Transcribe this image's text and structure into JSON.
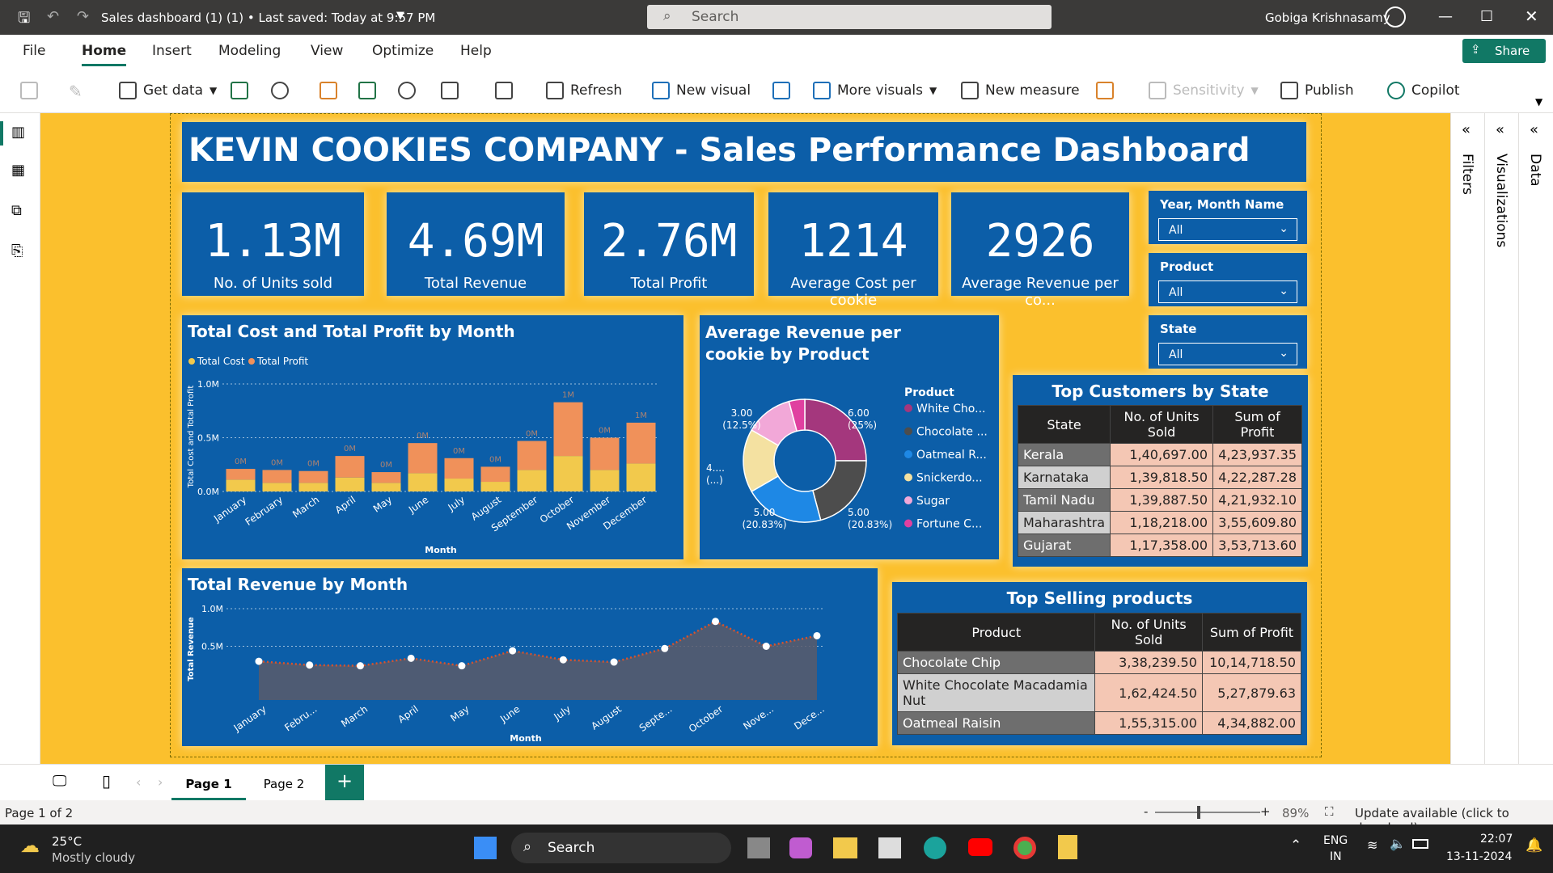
{
  "titlebar": {
    "title": "Sales dashboard (1) (1) • Last saved: Today at 9:57 PM",
    "search": "Search",
    "user": "Gobiga Krishnasamy"
  },
  "menu": [
    "File",
    "Home",
    "Insert",
    "Modeling",
    "View",
    "Optimize",
    "Help"
  ],
  "share": "Share",
  "ribbon": {
    "get_data": "Get data",
    "refresh": "Refresh",
    "new_visual": "New visual",
    "more_visuals": "More visuals",
    "new_measure": "New measure",
    "sensitivity": "Sensitivity",
    "publish": "Publish",
    "copilot": "Copilot"
  },
  "panes": {
    "filters": "Filters",
    "visualizations": "Visualizations",
    "data": "Data"
  },
  "dashboard": {
    "title": "KEVIN COOKIES COMPANY - Sales Performance Dashboard"
  },
  "kpis": [
    {
      "value": "1.13M",
      "label": "No. of Units sold"
    },
    {
      "value": "4.69M",
      "label": "Total Revenue"
    },
    {
      "value": "2.76M",
      "label": "Total Profit"
    },
    {
      "value": "1214",
      "label": "Average Cost per cookie"
    },
    {
      "value": "2926",
      "label": "Average Revenue per co..."
    }
  ],
  "slicers": [
    {
      "label": "Year, Month Name",
      "value": "All"
    },
    {
      "label": "Product",
      "value": "All"
    },
    {
      "label": "State",
      "value": "All"
    }
  ],
  "colors": {
    "cost": "#f2c94c",
    "profit": "#f0915a",
    "card": "#0c5ea8",
    "canvas": "#fbc02d"
  },
  "chart_data": [
    {
      "id": "cost_profit",
      "type": "bar",
      "title": "Total Cost and Total Profit by Month",
      "xlabel": "Month",
      "ylabel": "Total Cost and Total Profit",
      "yticks": [
        "1.0M",
        "0.5M",
        "0.0M"
      ],
      "legend": [
        "Total Cost",
        "Total Profit"
      ],
      "categories": [
        "January",
        "February",
        "March",
        "April",
        "May",
        "June",
        "July",
        "August",
        "September",
        "October",
        "November",
        "December"
      ],
      "series": [
        {
          "name": "Total Cost",
          "values": [
            0.11,
            0.08,
            0.08,
            0.13,
            0.08,
            0.17,
            0.12,
            0.09,
            0.2,
            0.33,
            0.2,
            0.26
          ]
        },
        {
          "name": "Total Profit",
          "values": [
            0.1,
            0.12,
            0.11,
            0.2,
            0.1,
            0.28,
            0.19,
            0.14,
            0.27,
            0.5,
            0.3,
            0.38
          ]
        }
      ],
      "data_labels": [
        "0M",
        "0M",
        "0M",
        "0M",
        "0M",
        "0M",
        "0M",
        "0M",
        "0M",
        "1M",
        "0M",
        "1M"
      ],
      "ylim": [
        0,
        1.0
      ]
    },
    {
      "id": "avg_rev_pie",
      "type": "pie",
      "title": "Average Revenue per cookie by Product",
      "legend_title": "Product",
      "categories": [
        "White Cho...",
        "Chocolate ...",
        "Oatmeal R...",
        "Snickerdo...",
        "Sugar",
        "Fortune C..."
      ],
      "values": [
        6.0,
        5.0,
        5.0,
        4.0,
        3.0,
        1.0
      ],
      "slice_labels": [
        "6.00\n(25%)",
        "5.00\n(20.83%)",
        "5.00\n(20.83%)",
        "4....\n(...)",
        "3.00\n(12.5%)",
        ""
      ],
      "colors": [
        "#a4377d",
        "#4d4d4d",
        "#1e88e5",
        "#f4e1a1",
        "#f2a8d8",
        "#e040a0"
      ]
    },
    {
      "id": "revenue_month",
      "type": "line",
      "title": "Total Revenue by Month",
      "xlabel": "Month",
      "ylabel": "Total Revenue",
      "yticks": [
        "1.0M",
        "0.5M"
      ],
      "categories": [
        "January",
        "Febru...",
        "March",
        "April",
        "May",
        "June",
        "July",
        "August",
        "Septe...",
        "October",
        "Nove...",
        "Dece..."
      ],
      "values": [
        0.3,
        0.25,
        0.24,
        0.34,
        0.24,
        0.44,
        0.32,
        0.29,
        0.47,
        0.83,
        0.5,
        0.64
      ],
      "ylim": [
        0,
        1.1
      ]
    }
  ],
  "customers": {
    "title": "Top Customers by State",
    "headers": [
      "State",
      "No. of Units Sold",
      "Sum of Profit"
    ],
    "rows": [
      [
        "Kerala",
        "1,40,697.00",
        "4,23,937.35"
      ],
      [
        "Karnataka",
        "1,39,818.50",
        "4,22,287.28"
      ],
      [
        "Tamil Nadu",
        "1,39,887.50",
        "4,21,932.10"
      ],
      [
        "Maharashtra",
        "1,18,218.00",
        "3,55,609.80"
      ],
      [
        "Gujarat",
        "1,17,358.00",
        "3,53,713.60"
      ]
    ]
  },
  "products": {
    "title": "Top Selling products",
    "headers": [
      "Product",
      "No. of Units Sold",
      "Sum of Profit"
    ],
    "rows": [
      [
        "Chocolate Chip",
        "3,38,239.50",
        "10,14,718.50"
      ],
      [
        "White Chocolate Macadamia Nut",
        "1,62,424.50",
        "5,27,879.63"
      ],
      [
        "Oatmeal Raisin",
        "1,55,315.00",
        "4,34,882.00"
      ]
    ]
  },
  "pages": [
    "Page 1",
    "Page 2"
  ],
  "status": {
    "page": "Page 1 of 2",
    "zoom": "89%",
    "update": "Update available (click to download)"
  },
  "taskbar": {
    "temp": "25°C",
    "weather": "Mostly cloudy",
    "search": "Search",
    "lang1": "ENG",
    "lang2": "IN",
    "time": "22:07",
    "date": "13-11-2024"
  }
}
